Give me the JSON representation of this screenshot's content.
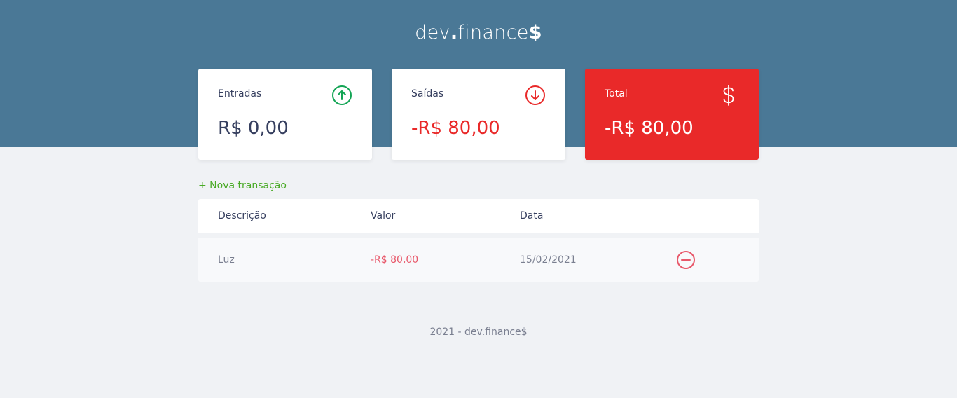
{
  "header": {
    "logo_prefix": "dev",
    "logo_dot": ".",
    "logo_main": "finance",
    "logo_suffix": "$",
    "background": "#4a7896"
  },
  "cards": [
    {
      "title": "Entradas",
      "value": "R$ 0,00",
      "icon": "arrow-up-circle-icon",
      "icon_color": "#12a454"
    },
    {
      "title": "Saídas",
      "value": "-R$ 80,00",
      "icon": "arrow-down-circle-icon",
      "icon_color": "#e92929"
    },
    {
      "title": "Total",
      "value": "-R$ 80,00",
      "icon": "dollar-sign-icon",
      "background": "#e92929"
    }
  ],
  "actions": {
    "new_transaction": "+ Nova transação"
  },
  "table": {
    "headers": [
      "Descrição",
      "Valor",
      "Data",
      ""
    ],
    "rows": [
      {
        "description": "Luz",
        "amount": "-R$ 80,00",
        "date": "15/02/2021",
        "action_icon": "minus-circle-icon"
      }
    ]
  },
  "footer": {
    "text": "2021 - dev.finance$"
  },
  "colors": {
    "income": "#12a454",
    "expense": "#e92929",
    "link": "#49aa26",
    "page_background": "#f0f2f5"
  }
}
